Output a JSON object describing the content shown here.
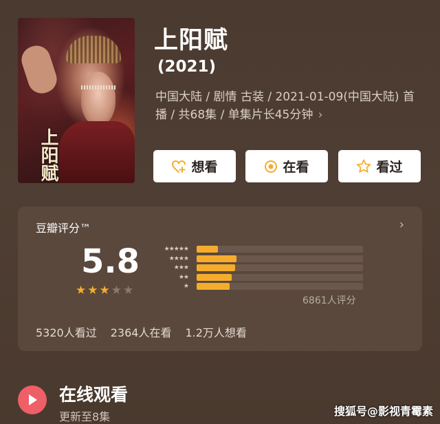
{
  "poster": {
    "alt": "上阳赋 poster",
    "calligraphy": "上阳赋"
  },
  "show": {
    "title": "上阳赋",
    "year": "(2021)",
    "meta": "中国大陆 / 剧情 古装 / 2021-01-09(中国大陆) 首播 / 共68集 / 单集片长45分钟",
    "meta_chevron": "›"
  },
  "actions": [
    {
      "label": "想看",
      "icon": "heart-plus-icon"
    },
    {
      "label": "在看",
      "icon": "target-circle-icon"
    },
    {
      "label": "看过",
      "icon": "star-outline-icon"
    }
  ],
  "rating": {
    "header": "豆瓣评分™",
    "arrow": "›",
    "score": "5.8",
    "stars_filled": 3,
    "stars_total": 5,
    "distribution": [
      {
        "stars": "★★★★★",
        "fraction": 0.13
      },
      {
        "stars": "★★★★",
        "fraction": 0.24
      },
      {
        "stars": "★★★",
        "fraction": 0.23
      },
      {
        "stars": "★★",
        "fraction": 0.21
      },
      {
        "stars": "★",
        "fraction": 0.2
      }
    ],
    "count_label": "6861人评分",
    "stats": [
      "5320人看过",
      "2364人在看",
      "1.2万人想看"
    ]
  },
  "watch": {
    "title": "在线观看",
    "subtitle": "更新至8集"
  },
  "watermark": "搜狐号@影视青霉素",
  "colors": {
    "star_filled": "#f5ac2c",
    "star_empty": "#8a7a6f",
    "bar_fill": "#f5ac2c",
    "play_icon": "#ee5f67"
  }
}
